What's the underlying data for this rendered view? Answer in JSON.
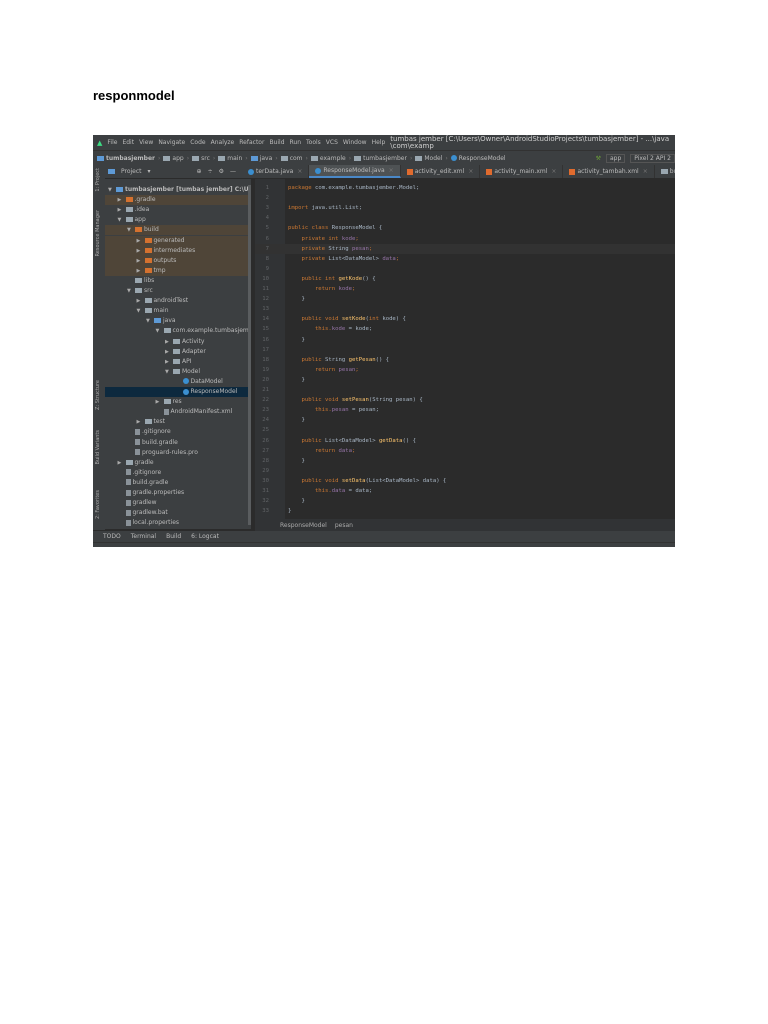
{
  "document": {
    "title": "responmodel"
  },
  "ide": {
    "menu": [
      "File",
      "Edit",
      "View",
      "Navigate",
      "Code",
      "Analyze",
      "Refactor",
      "Build",
      "Run",
      "Tools",
      "VCS",
      "Window",
      "Help"
    ],
    "window_title": "tumbas jember [C:\\Users\\Owner\\AndroidStudioProjects\\tumbasjember] - ...\\java\\com\\examp",
    "breadcrumbs": [
      "tumbasjember",
      "app",
      "src",
      "main",
      "java",
      "com",
      "example",
      "tumbasjember",
      "Model",
      "ResponseModel"
    ],
    "run_config": "app",
    "device": "Pixel 2 API 2",
    "project_view": "Project",
    "tabs": [
      {
        "label": "terData.java",
        "type": "class",
        "active": false
      },
      {
        "label": "ResponseModel.java",
        "type": "class",
        "active": true
      },
      {
        "label": "activity_edit.xml",
        "type": "xml",
        "active": false
      },
      {
        "label": "activity_main.xml",
        "type": "xml",
        "active": false
      },
      {
        "label": "activity_tambah.xml",
        "type": "xml",
        "active": false
      },
      {
        "label": "build.gradle (ap",
        "type": "gradle",
        "active": false
      }
    ],
    "side_tools": [
      "1: Project",
      "Resource Manager",
      "Z: Structure",
      "Build Variants",
      "2: Favorites"
    ],
    "tree": [
      {
        "label": "tumbasjember [tumbas jember]  C:\\Users\\Ov",
        "depth": 0,
        "arrow": "down",
        "icon": "blue",
        "style": ""
      },
      {
        "label": ".gradle",
        "depth": 1,
        "arrow": "right",
        "icon": "orange",
        "style": "hl"
      },
      {
        "label": ".idea",
        "depth": 1,
        "arrow": "right",
        "icon": "grey",
        "style": ""
      },
      {
        "label": "app",
        "depth": 1,
        "arrow": "down",
        "icon": "grey",
        "style": ""
      },
      {
        "label": "build",
        "depth": 2,
        "arrow": "down",
        "icon": "orange",
        "style": "hl"
      },
      {
        "label": "generated",
        "depth": 3,
        "arrow": "right",
        "icon": "orange",
        "style": "hl"
      },
      {
        "label": "intermediates",
        "depth": 3,
        "arrow": "right",
        "icon": "orange",
        "style": "hl"
      },
      {
        "label": "outputs",
        "depth": 3,
        "arrow": "right",
        "icon": "orange",
        "style": "hl"
      },
      {
        "label": "tmp",
        "depth": 3,
        "arrow": "right",
        "icon": "orange",
        "style": "hl"
      },
      {
        "label": "libs",
        "depth": 2,
        "arrow": "",
        "icon": "grey",
        "style": ""
      },
      {
        "label": "src",
        "depth": 2,
        "arrow": "down",
        "icon": "grey",
        "style": ""
      },
      {
        "label": "androidTest",
        "depth": 3,
        "arrow": "right",
        "icon": "grey",
        "style": ""
      },
      {
        "label": "main",
        "depth": 3,
        "arrow": "down",
        "icon": "grey",
        "style": ""
      },
      {
        "label": "java",
        "depth": 4,
        "arrow": "down",
        "icon": "blue",
        "style": ""
      },
      {
        "label": "com.example.tumbasjember",
        "depth": 5,
        "arrow": "down",
        "icon": "grey",
        "style": ""
      },
      {
        "label": "Activity",
        "depth": 6,
        "arrow": "right",
        "icon": "grey",
        "style": ""
      },
      {
        "label": "Adapter",
        "depth": 6,
        "arrow": "right",
        "icon": "grey",
        "style": ""
      },
      {
        "label": "API",
        "depth": 6,
        "arrow": "right",
        "icon": "grey",
        "style": ""
      },
      {
        "label": "Model",
        "depth": 6,
        "arrow": "down",
        "icon": "grey",
        "style": ""
      },
      {
        "label": "DataModel",
        "depth": 7,
        "arrow": "",
        "icon": "class",
        "style": ""
      },
      {
        "label": "ResponseModel",
        "depth": 7,
        "arrow": "",
        "icon": "class",
        "style": "sel"
      },
      {
        "label": "res",
        "depth": 5,
        "arrow": "right",
        "icon": "grey",
        "style": ""
      },
      {
        "label": "AndroidManifest.xml",
        "depth": 5,
        "arrow": "",
        "icon": "file",
        "style": ""
      },
      {
        "label": "test",
        "depth": 3,
        "arrow": "right",
        "icon": "grey",
        "style": ""
      },
      {
        "label": ".gitignore",
        "depth": 2,
        "arrow": "",
        "icon": "file",
        "style": ""
      },
      {
        "label": "build.gradle",
        "depth": 2,
        "arrow": "",
        "icon": "file",
        "style": ""
      },
      {
        "label": "proguard-rules.pro",
        "depth": 2,
        "arrow": "",
        "icon": "file",
        "style": ""
      },
      {
        "label": "gradle",
        "depth": 1,
        "arrow": "right",
        "icon": "grey",
        "style": ""
      },
      {
        "label": ".gitignore",
        "depth": 1,
        "arrow": "",
        "icon": "file",
        "style": ""
      },
      {
        "label": "build.gradle",
        "depth": 1,
        "arrow": "",
        "icon": "file",
        "style": ""
      },
      {
        "label": "gradle.properties",
        "depth": 1,
        "arrow": "",
        "icon": "file",
        "style": ""
      },
      {
        "label": "gradlew",
        "depth": 1,
        "arrow": "",
        "icon": "file",
        "style": ""
      },
      {
        "label": "gradlew.bat",
        "depth": 1,
        "arrow": "",
        "icon": "file",
        "style": ""
      },
      {
        "label": "local.properties",
        "depth": 1,
        "arrow": "",
        "icon": "file",
        "style": ""
      },
      {
        "label": "settings.gradle",
        "depth": 1,
        "arrow": "",
        "icon": "file",
        "style": ""
      }
    ],
    "code": [
      [
        [
          "package ",
          "kw"
        ],
        [
          "com.example.tumbasjember.Model;",
          "pl"
        ]
      ],
      [],
      [
        [
          "import ",
          "kw"
        ],
        [
          "java.util.List;",
          "pl"
        ]
      ],
      [],
      [
        [
          "public class ",
          "kw"
        ],
        [
          "ResponseModel {",
          "pl"
        ]
      ],
      [
        [
          "    private int ",
          "kw"
        ],
        [
          "kode",
          "fld"
        ],
        [
          ";",
          "kw"
        ]
      ],
      [
        [
          "    private ",
          "kw"
        ],
        [
          "String ",
          "pl"
        ],
        [
          "pesan",
          "fld"
        ],
        [
          ";",
          "kw"
        ]
      ],
      [
        [
          "    private ",
          "kw"
        ],
        [
          "List<DataModel> ",
          "pl"
        ],
        [
          "data",
          "fld"
        ],
        [
          ";",
          "kw"
        ]
      ],
      [],
      [
        [
          "    public int ",
          "kw"
        ],
        [
          "getKode",
          "fn"
        ],
        [
          "() {",
          "pl"
        ]
      ],
      [
        [
          "        return ",
          "kw"
        ],
        [
          "kode",
          "fld"
        ],
        [
          ";",
          "kw"
        ]
      ],
      [
        [
          "    }",
          "pl"
        ]
      ],
      [],
      [
        [
          "    public void ",
          "kw"
        ],
        [
          "setKode",
          "fn"
        ],
        [
          "(",
          "pl"
        ],
        [
          "int ",
          "kw"
        ],
        [
          "kode) {",
          "pl"
        ]
      ],
      [
        [
          "        this.",
          "kw"
        ],
        [
          "kode",
          "fld"
        ],
        [
          " = kode;",
          "pl"
        ]
      ],
      [
        [
          "    }",
          "pl"
        ]
      ],
      [],
      [
        [
          "    public ",
          "kw"
        ],
        [
          "String ",
          "pl"
        ],
        [
          "getPesan",
          "fn"
        ],
        [
          "() {",
          "pl"
        ]
      ],
      [
        [
          "        return ",
          "kw"
        ],
        [
          "pesan",
          "fld"
        ],
        [
          ";",
          "kw"
        ]
      ],
      [
        [
          "    }",
          "pl"
        ]
      ],
      [],
      [
        [
          "    public void ",
          "kw"
        ],
        [
          "setPesan",
          "fn"
        ],
        [
          "(String pesan) {",
          "pl"
        ]
      ],
      [
        [
          "        this.",
          "kw"
        ],
        [
          "pesan",
          "fld"
        ],
        [
          " = pesan;",
          "pl"
        ]
      ],
      [
        [
          "    }",
          "pl"
        ]
      ],
      [],
      [
        [
          "    public ",
          "kw"
        ],
        [
          "List<DataModel> ",
          "pl"
        ],
        [
          "getData",
          "fn"
        ],
        [
          "() {",
          "pl"
        ]
      ],
      [
        [
          "        return ",
          "kw"
        ],
        [
          "data",
          "fld"
        ],
        [
          ";",
          "kw"
        ]
      ],
      [
        [
          "    }",
          "pl"
        ]
      ],
      [],
      [
        [
          "    public void ",
          "kw"
        ],
        [
          "setData",
          "fn"
        ],
        [
          "(List<DataModel> data) {",
          "pl"
        ]
      ],
      [
        [
          "        this.",
          "kw"
        ],
        [
          "data",
          "fld"
        ],
        [
          " = data;",
          "pl"
        ]
      ],
      [
        [
          "    }",
          "pl"
        ]
      ],
      [
        [
          "}",
          "pl"
        ]
      ]
    ],
    "current_line": 7,
    "editor_breadcrumb": [
      "ResponseModel",
      "pesan"
    ],
    "tool_windows": [
      "TODO",
      "Terminal",
      "Build",
      "6: Logcat"
    ]
  }
}
